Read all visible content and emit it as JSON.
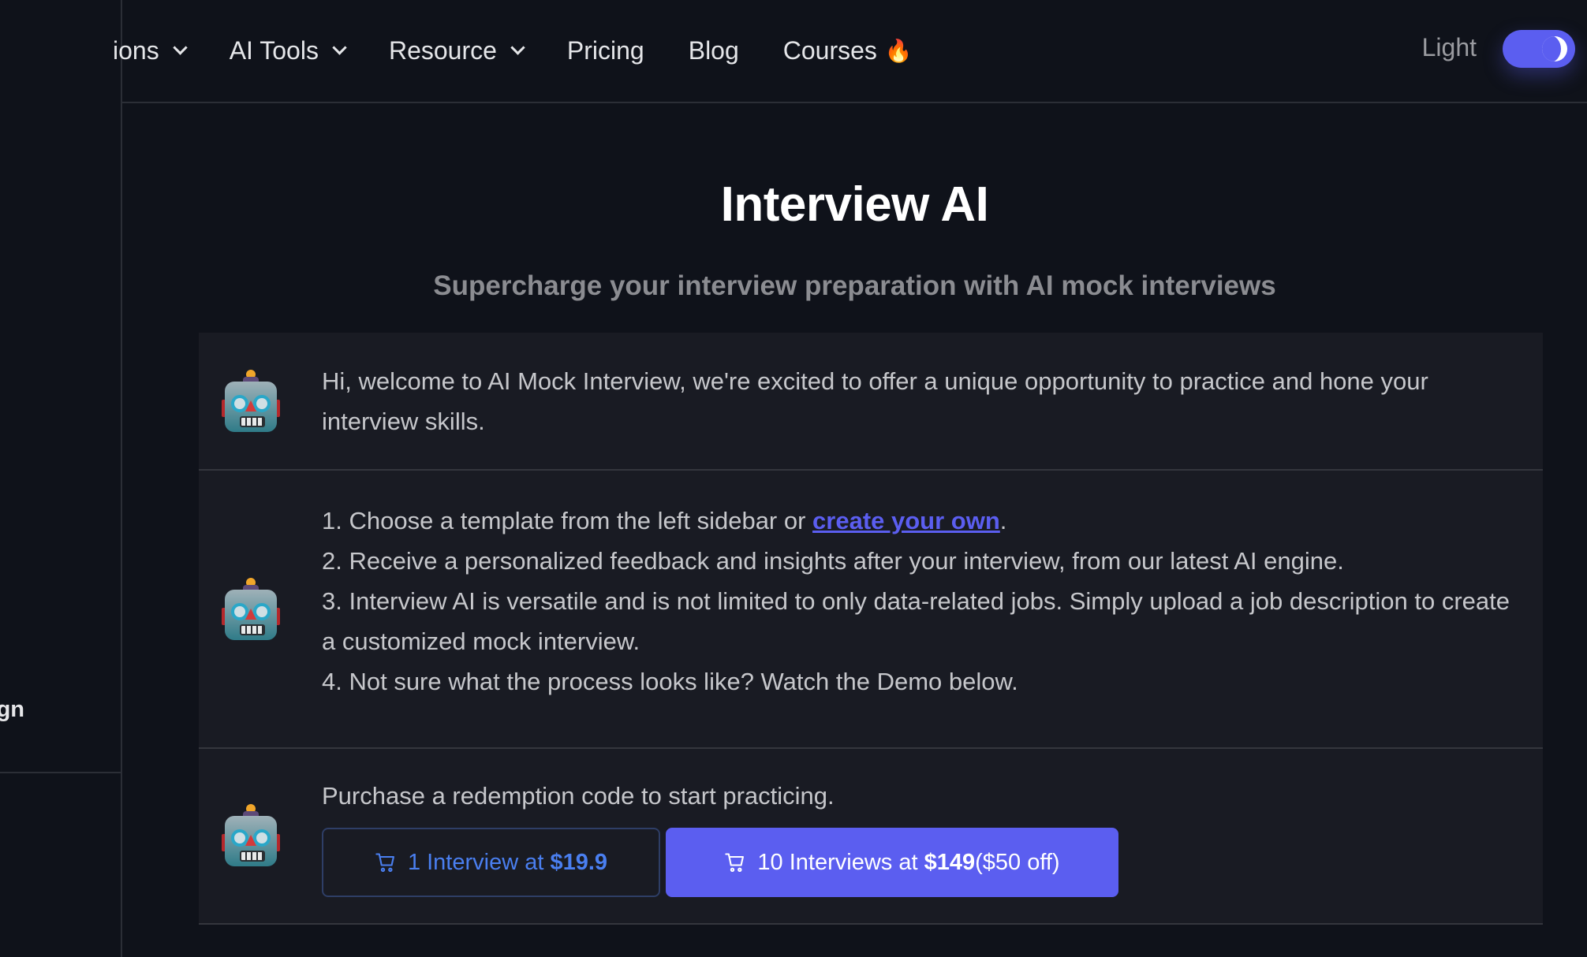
{
  "sidebar": {
    "partial_item_label": "gn"
  },
  "header": {
    "nav": [
      {
        "label": "ions",
        "has_dropdown": true
      },
      {
        "label": "AI Tools",
        "has_dropdown": true
      },
      {
        "label": "Resource",
        "has_dropdown": true
      },
      {
        "label": "Pricing",
        "has_dropdown": false
      },
      {
        "label": "Blog",
        "has_dropdown": false
      },
      {
        "label": "Courses",
        "badge_icon": "🔥",
        "has_dropdown": false
      }
    ],
    "theme_label": "Light",
    "theme_toggle": {
      "state": "dark",
      "icon": "moon-icon"
    }
  },
  "page": {
    "title": "Interview AI",
    "subtitle": "Supercharge your interview preparation with AI mock interviews"
  },
  "messages": [
    {
      "avatar": "robot-icon",
      "text": "Hi, welcome to AI Mock Interview, we're excited to offer a unique opportunity to practice and hone your interview skills."
    },
    {
      "avatar": "robot-icon",
      "steps": {
        "s1_prefix": "1. Choose a template from the left sidebar or ",
        "s1_link": "create your own",
        "s1_suffix": ".",
        "s2": "2. Receive a personalized feedback and insights after your interview, from our latest AI engine.",
        "s3": "3. Interview AI is versatile and is not limited to only data-related jobs. Simply upload a job description to create a customized mock interview.",
        "s4": "4. Not sure what the process looks like? Watch the Demo below."
      }
    },
    {
      "avatar": "robot-icon",
      "text": "Purchase a redemption code to start practicing.",
      "buttons": [
        {
          "prefix": "1 Interview at ",
          "price": "$19.9",
          "suffix": "",
          "icon": "cart-icon"
        },
        {
          "prefix": "10 Interviews at ",
          "price": "$149",
          "suffix": "($50 off)",
          "icon": "cart-icon"
        }
      ]
    }
  ],
  "colors": {
    "accent": "#5b5ef0",
    "outline_button_text": "#4a7ff0",
    "background": "#0f121a",
    "panel": "#191b23"
  }
}
